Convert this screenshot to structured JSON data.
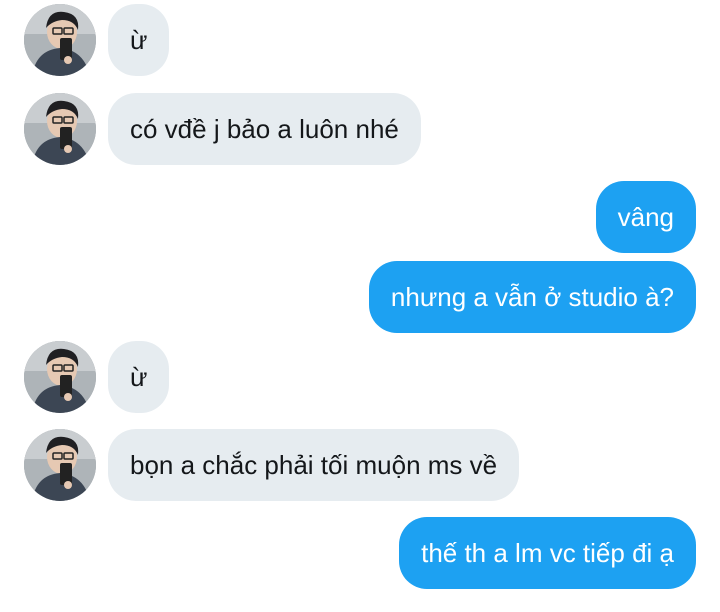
{
  "conversation": {
    "messages": [
      {
        "sender": "other",
        "text": "ừ"
      },
      {
        "sender": "other",
        "text": "có vđề j bảo a luôn nhé"
      },
      {
        "sender": "me",
        "text": "vâng"
      },
      {
        "sender": "me",
        "text": "nhưng a vẫn ở studio à?"
      },
      {
        "sender": "other",
        "text": "ừ"
      },
      {
        "sender": "other",
        "text": "bọn a chắc phải tối muộn ms về"
      },
      {
        "sender": "me",
        "text": "thế th a lm vc tiếp đi ạ"
      }
    ]
  },
  "colors": {
    "incoming_bubble": "#e6ecf0",
    "incoming_text": "#14171a",
    "outgoing_bubble": "#1da1f2",
    "outgoing_text": "#ffffff"
  },
  "icons": {
    "avatar": "user-avatar-photo"
  }
}
